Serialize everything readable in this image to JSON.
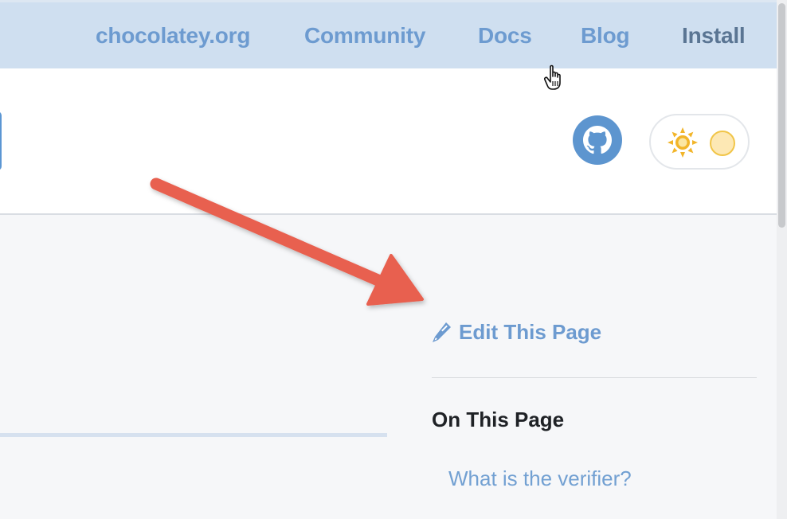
{
  "nav": {
    "items": [
      {
        "label": "chocolatey.org"
      },
      {
        "label": "Community"
      },
      {
        "label": "Docs"
      },
      {
        "label": "Blog"
      },
      {
        "label": "Install"
      }
    ]
  },
  "header": {
    "github_icon": "github-icon",
    "theme_toggle": {
      "sun_icon": "sun-icon",
      "moon_icon": "moon-icon"
    }
  },
  "sidebar": {
    "edit_label": "Edit This Page",
    "edit_icon": "pencil-icon",
    "toc_title": "On This Page",
    "toc_items": [
      {
        "label": "What is the verifier?"
      }
    ]
  },
  "annotation": {
    "arrow_color": "#e8604f"
  },
  "colors": {
    "nav_bg": "#cfdff0",
    "link": "#6d9bd0",
    "accent": "#5d95cf"
  }
}
